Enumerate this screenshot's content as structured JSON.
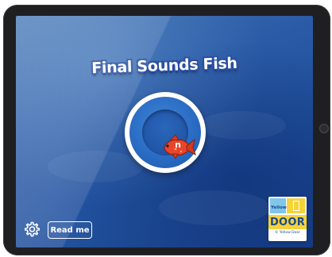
{
  "app": {
    "title": "Final Sounds Fish"
  },
  "play": {
    "fish_letter": "n"
  },
  "controls": {
    "settings_icon": "gear-icon",
    "read_me_label": "Read me"
  },
  "logo": {
    "small_text": "Yellow",
    "main_text": "DOOR",
    "credit_text": "© Yellow Door"
  },
  "colors": {
    "water": "#2a5aa6",
    "ring": "#ffffff",
    "fish": "#e8462a",
    "logo_yellow": "#f5d33a",
    "logo_blue": "#7fc6ea"
  }
}
